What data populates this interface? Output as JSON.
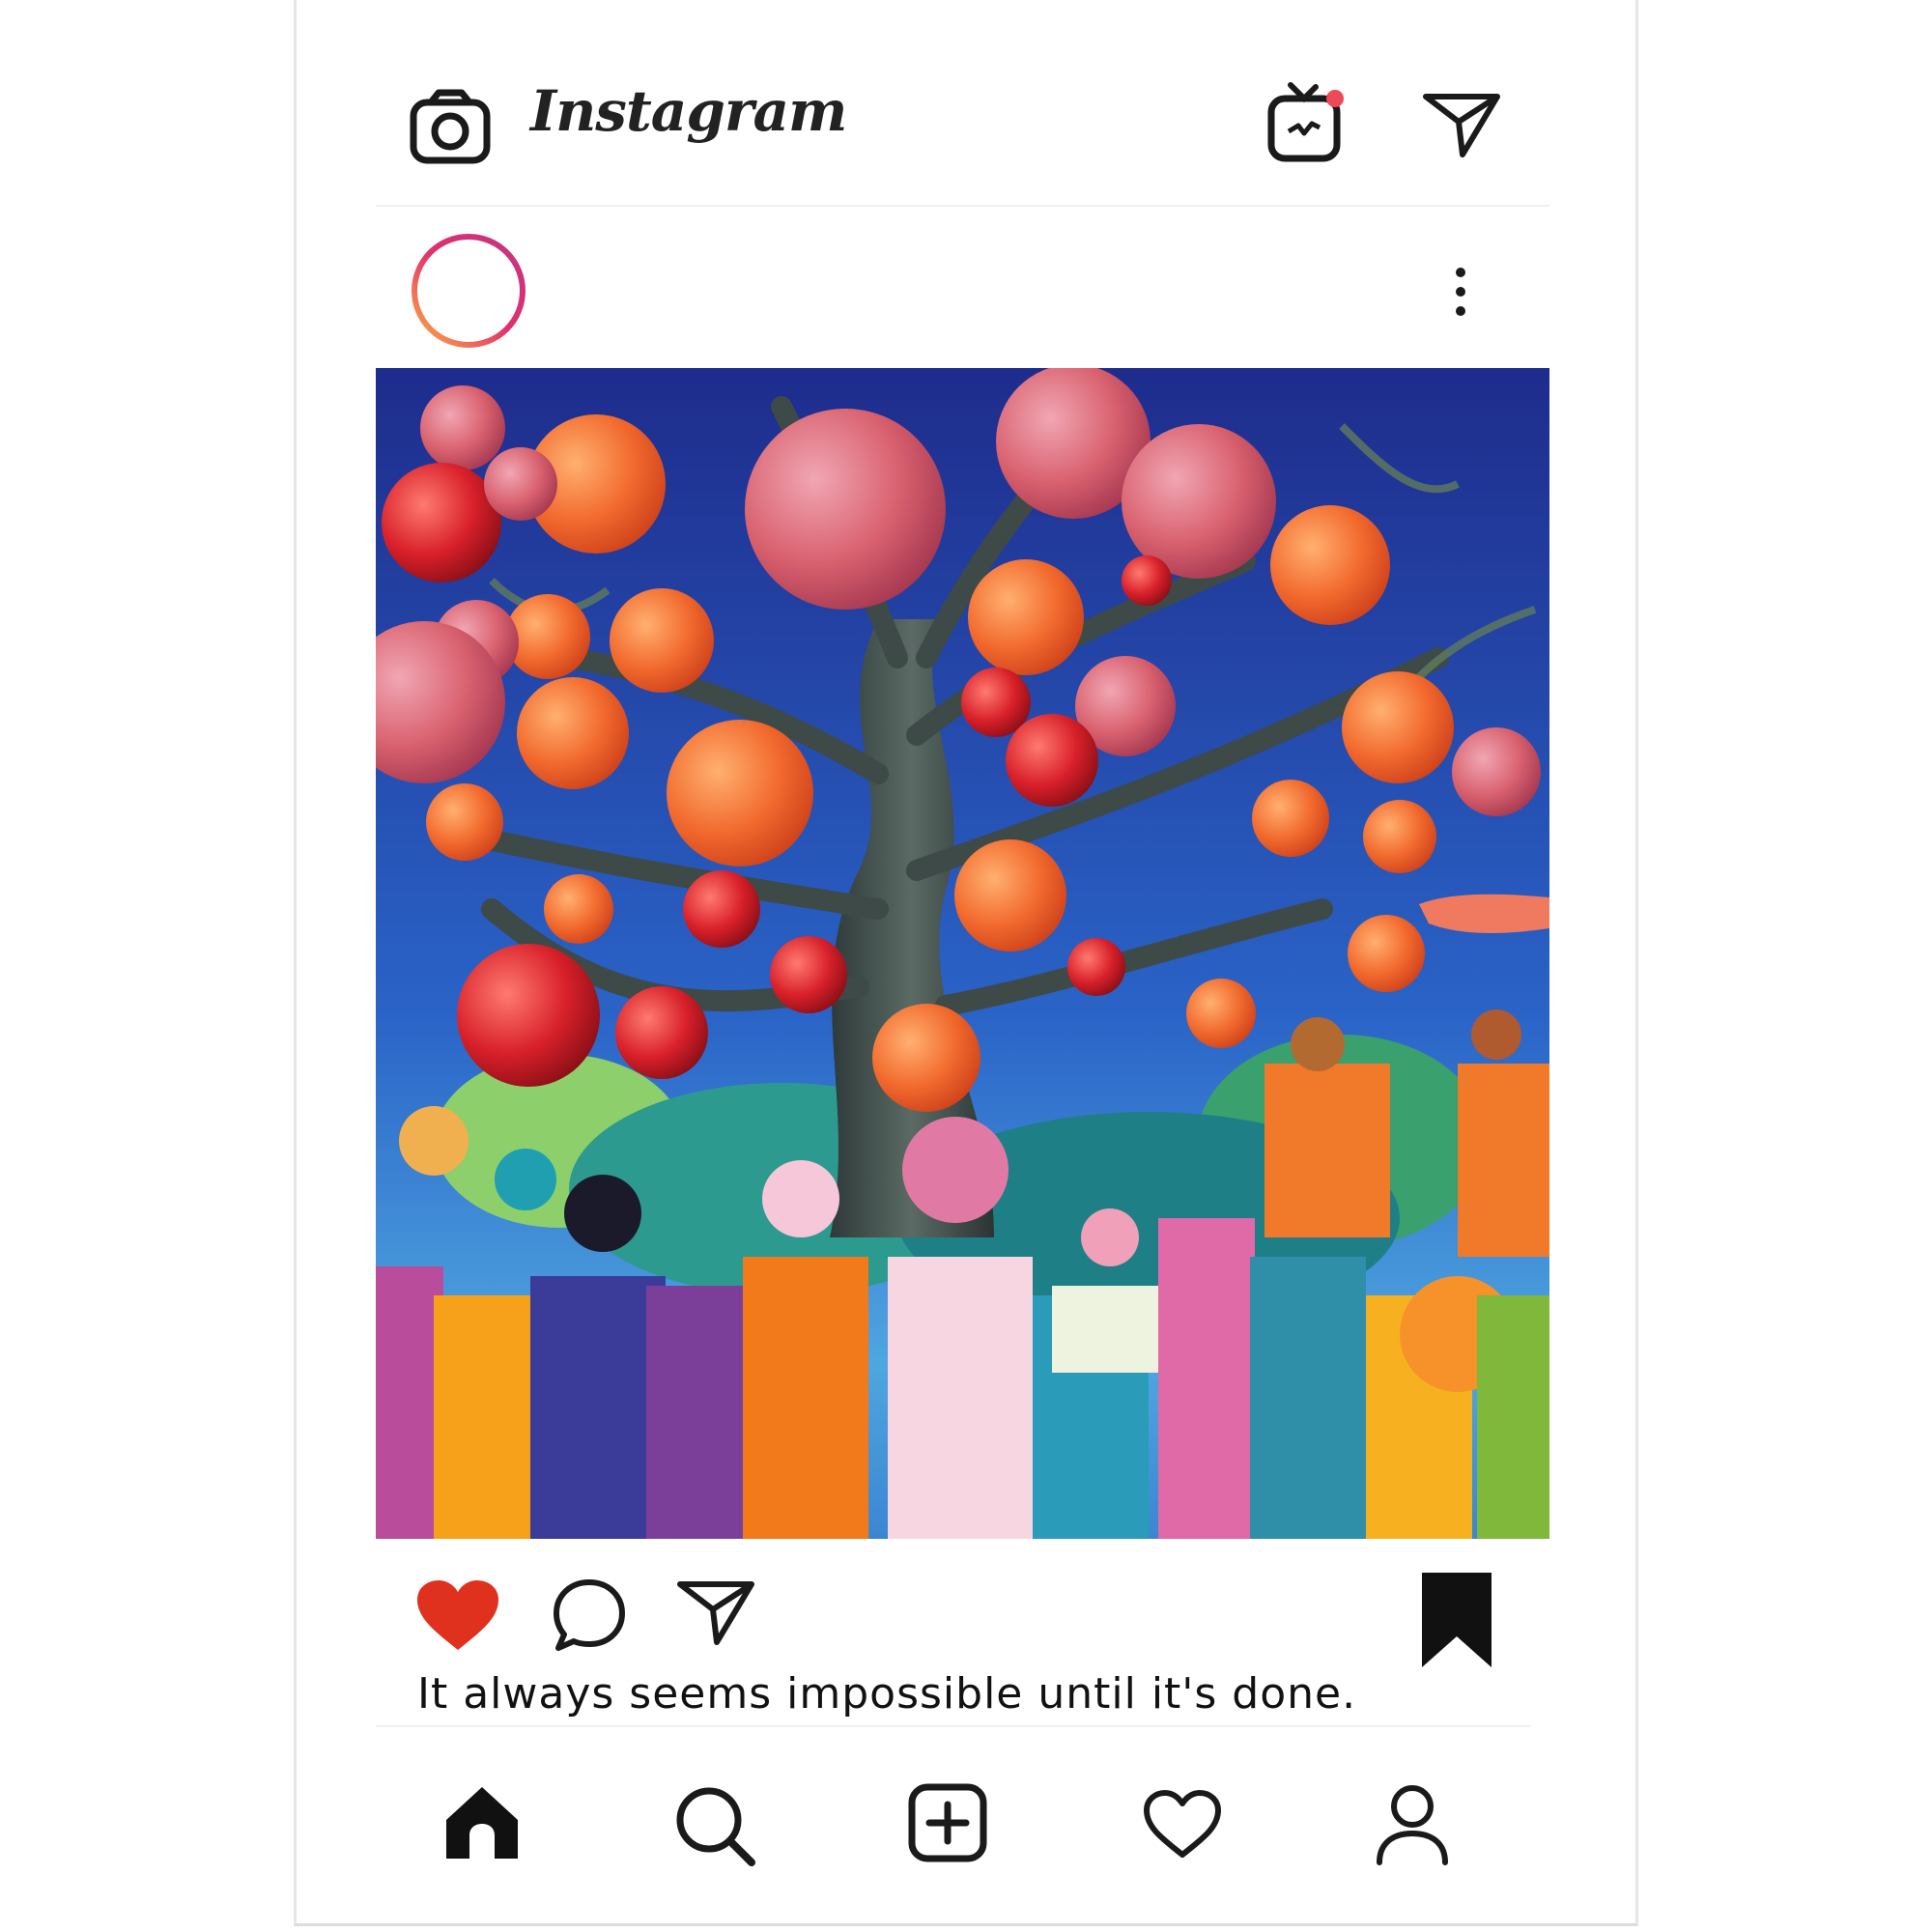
{
  "header": {
    "brand": "Instagram",
    "icons": {
      "camera": "camera-icon",
      "igtv": "igtv-icon",
      "direct": "paper-plane-icon"
    },
    "igtv_badge_color": "#ed4956"
  },
  "post": {
    "avatar_ring_colors": [
      "#d6249f",
      "#fd5949",
      "#fdb15c"
    ],
    "more_icon": "more-vertical-icon",
    "image": {
      "subject": "painting of a fruit tree with people gathered beneath it"
    },
    "actions": {
      "like_color": "#e0301e",
      "like_state": "liked",
      "saved_state": "saved"
    },
    "caption": "It always seems impossible until it's done."
  },
  "bottom_nav": {
    "items": [
      "home-icon",
      "search-icon",
      "add-post-icon",
      "activity-heart-icon",
      "profile-icon"
    ]
  }
}
